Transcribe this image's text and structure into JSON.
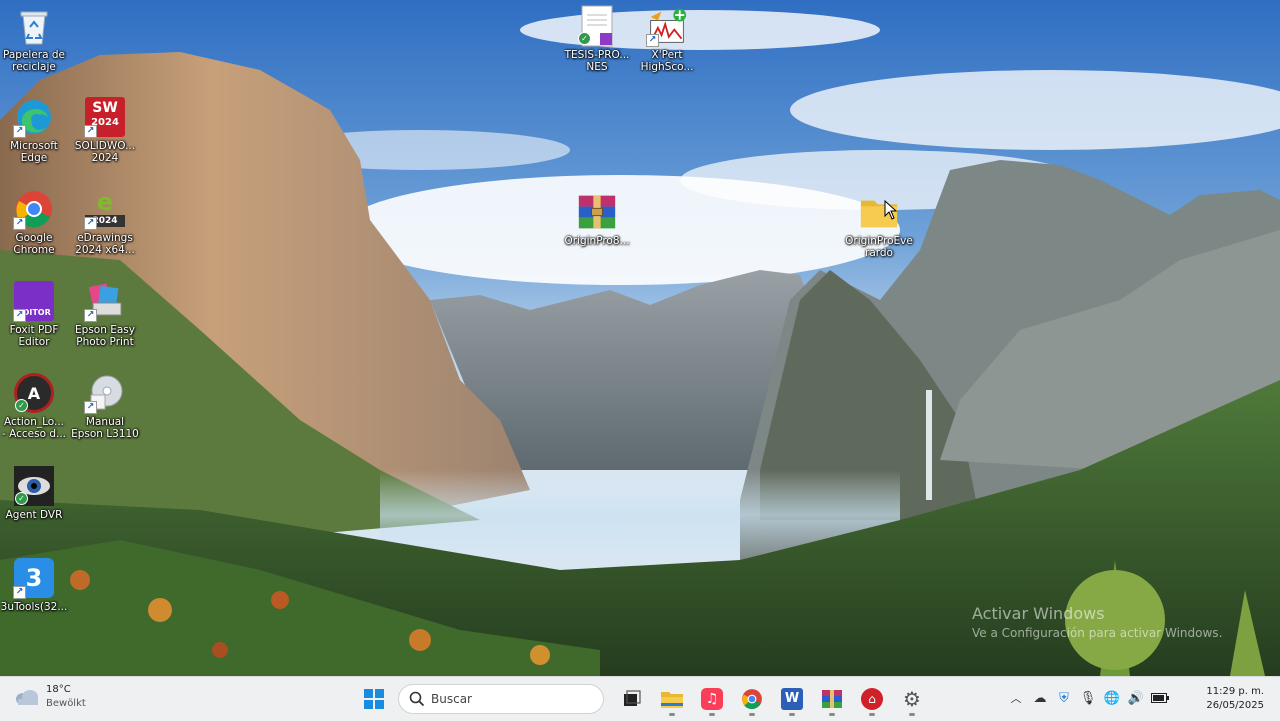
{
  "desktop": {
    "icons": {
      "recycle": "Papelera de\nreciclaje",
      "edge": "Microsoft\nEdge",
      "solidworks": "SOLIDWO...\n2024",
      "chrome": "Google\nChrome",
      "edrawings": "eDrawings\n2024 x64...",
      "foxit": "Foxit PDF\nEditor",
      "epson_photo": "Epson Easy\nPhoto Print",
      "action": "Action_Lo...\n- Acceso d...",
      "manual_epson": "Manual\nEpson L3110",
      "agent_dvr": "Agent DVR",
      "tools3u": "3uTools(32...",
      "tesis": "TESIS-PRO...\nNES",
      "xpert": "X'Pert\nHighSco...",
      "origin_rar": "OriginPro8...",
      "origin_folder": "OriginProEve\nrardo"
    },
    "badges": {
      "solidworks": "SW",
      "solidworks_year": "2024",
      "edrawings_year": "2024",
      "foxit": "EDITOR",
      "action": "A",
      "tools3u": "3"
    },
    "watermark": {
      "line1": "Activar Windows",
      "line2": "Ve a Configuración para activar Windows."
    }
  },
  "taskbar": {
    "weather": {
      "temp": "18°C",
      "condition": "Bewölkt"
    },
    "search_placeholder": "Buscar",
    "clock": {
      "time": "11:29 p. m.",
      "date": "26/05/2025"
    },
    "word_letter": "W"
  },
  "colors": {
    "accent": "#0067c0",
    "taskbar_bg": "#eef0f2"
  }
}
